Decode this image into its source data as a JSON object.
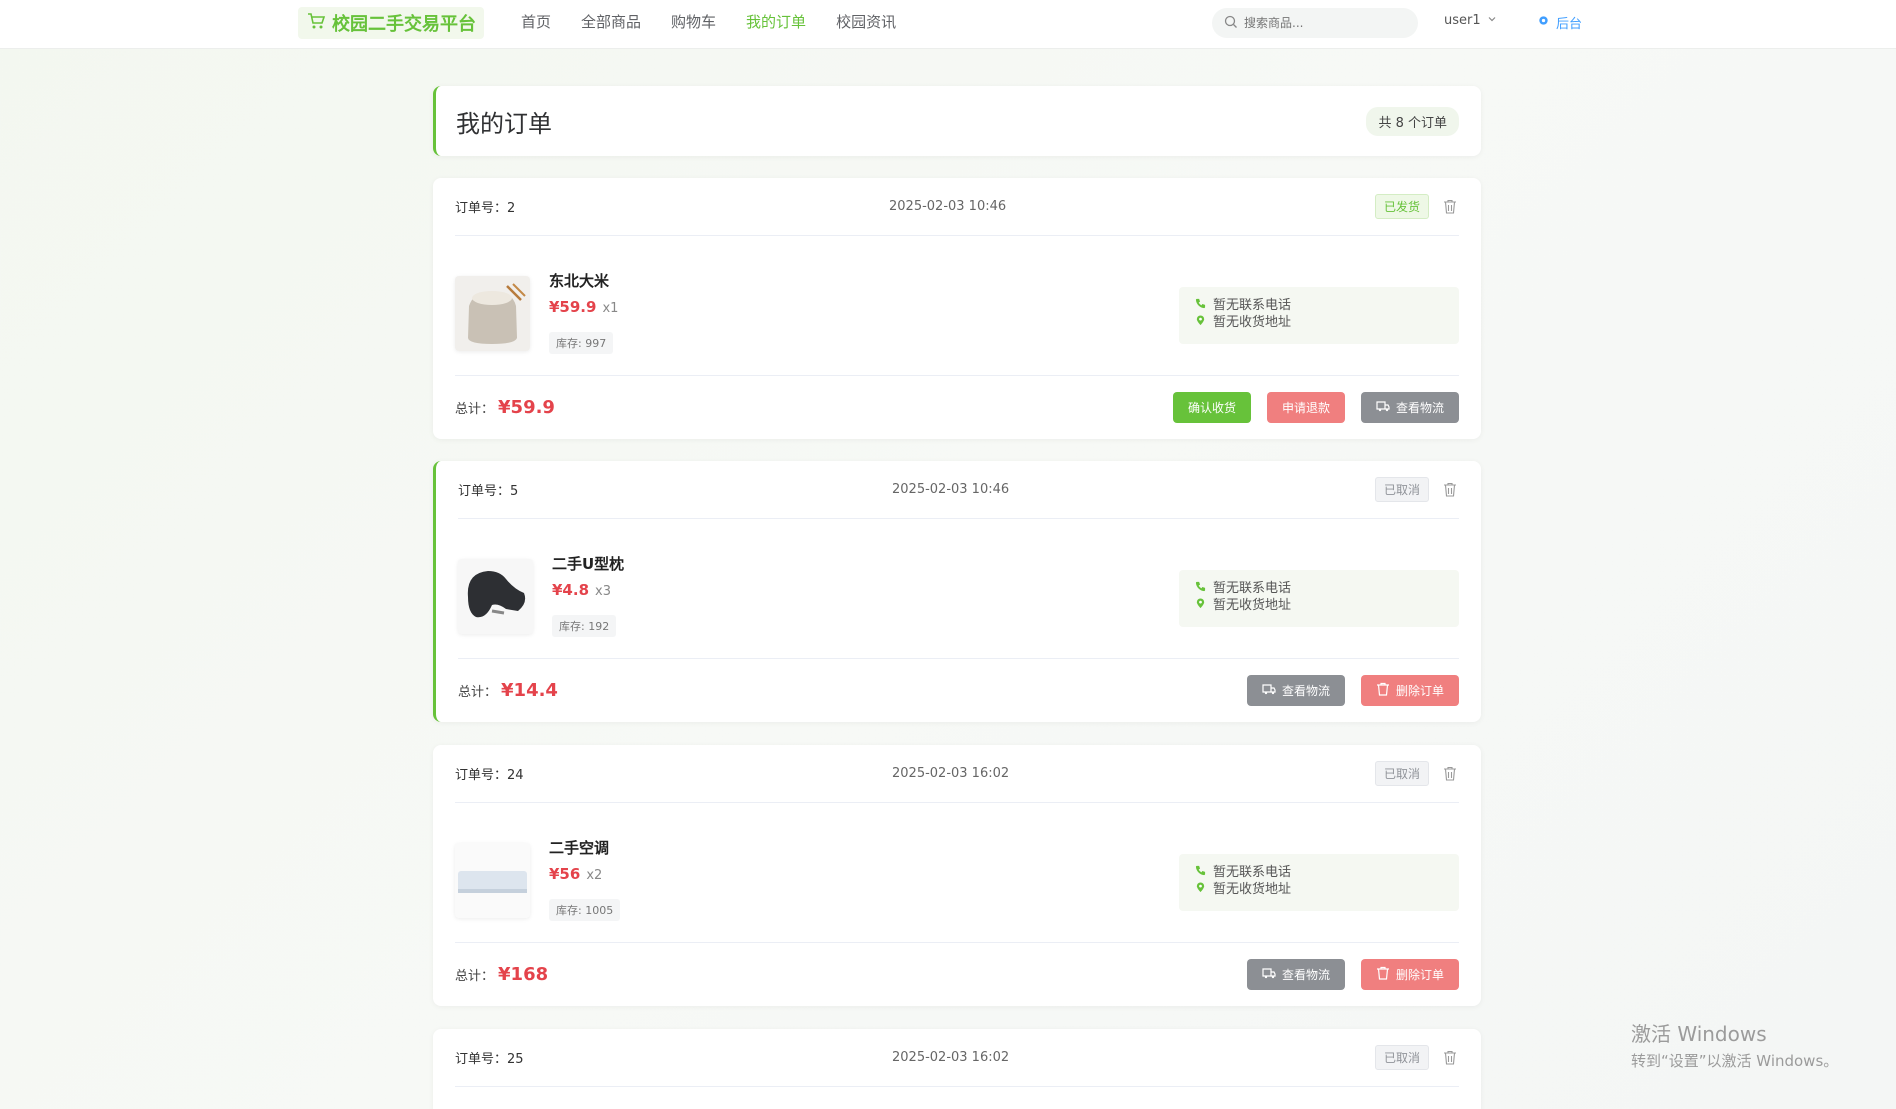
{
  "navbar": {
    "brand": "校园二手交易平台",
    "menu": [
      {
        "label": "首页",
        "active": false
      },
      {
        "label": "全部商品",
        "active": false
      },
      {
        "label": "购物车",
        "active": false
      },
      {
        "label": "我的订单",
        "active": true
      },
      {
        "label": "校园资讯",
        "active": false
      }
    ],
    "search_placeholder": "搜索商品...",
    "username": "user1",
    "admin_label": "后台"
  },
  "page": {
    "title": "我的订单",
    "count_text": "共 8 个订单"
  },
  "orders": [
    {
      "no_label": "订单号：2",
      "time": "2025-02-03 10:46",
      "status": "已发货",
      "product_name": "东北大米",
      "price": "¥59.9",
      "qty": "x1",
      "stock": "库存: 997",
      "phone": "暂无联系电话",
      "address": "暂无收货地址",
      "total_label": "总计：",
      "total": "¥59.9",
      "buttons": [
        "确认收货",
        "申请退款",
        "查看物流"
      ]
    },
    {
      "no_label": "订单号：5",
      "time": "2025-02-03 10:46",
      "status": "已取消",
      "product_name": "二手U型枕",
      "price": "¥4.8",
      "qty": "x3",
      "stock": "库存: 192",
      "phone": "暂无联系电话",
      "address": "暂无收货地址",
      "total_label": "总计：",
      "total": "¥14.4",
      "buttons": [
        "查看物流",
        "删除订单"
      ]
    },
    {
      "no_label": "订单号：24",
      "time": "2025-02-03 16:02",
      "status": "已取消",
      "product_name": "二手空调",
      "price": "¥56",
      "qty": "x2",
      "stock": "库存: 1005",
      "phone": "暂无联系电话",
      "address": "暂无收货地址",
      "total_label": "总计：",
      "total": "¥168",
      "buttons": [
        "查看物流",
        "删除订单"
      ]
    },
    {
      "no_label": "订单号：25",
      "time": "2025-02-03 16:02",
      "status": "已取消"
    }
  ],
  "watermark": {
    "title": "激活 Windows",
    "subtitle": "转到“设置”以激活 Windows。"
  },
  "colors": {
    "accent": "#67c23a",
    "price": "#e4434b",
    "danger_button": "#f07f7f",
    "gray_button": "#8c8f94"
  }
}
